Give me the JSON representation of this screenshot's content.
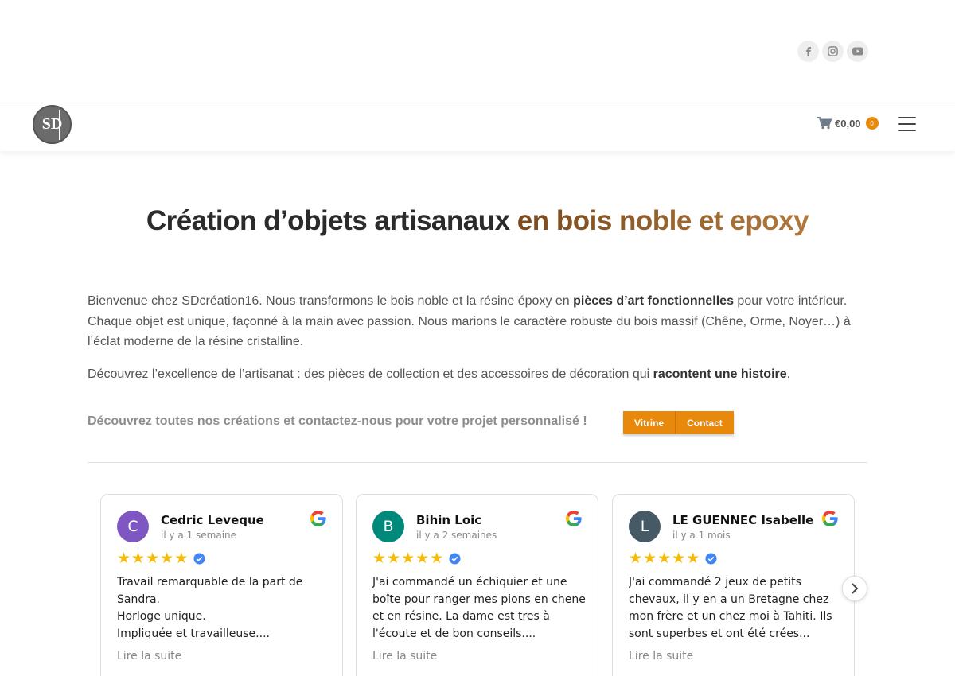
{
  "social": {
    "icons": [
      "facebook-icon",
      "instagram-icon",
      "youtube-icon"
    ]
  },
  "header": {
    "logo_text": "SD",
    "cart_amount": "€0,00",
    "cart_count": "0"
  },
  "hero": {
    "title_part1": "Création d’objets artisanaux ",
    "title_part2": "en bois noble et epoxy"
  },
  "intro": {
    "p1_a": "Bienvenue chez SDcréation16. Nous transformons le bois noble et la résine époxy en ",
    "p1_b": "pièces d’art fonctionnelles",
    "p1_c": " pour votre intérieur. Chaque objet est unique, façonné à la main avec passion. Nous marions le caractère robuste du bois massif (Chêne, Orme, Noyer…) à l’éclat moderne de la résine cristalline.",
    "p2_a": "Découvrez l’excellence de l’artisanat : des pièces de collection et des accessoires de décoration qui ",
    "p2_b": "racontent une histoire",
    "p2_c": "."
  },
  "cta": {
    "text": "Découvrez toutes nos créations et contactez-nous pour votre projet personnalisé !",
    "btn_vitrine": "Vitrine",
    "btn_contact": "Contact"
  },
  "reviews": [
    {
      "initial": "C",
      "avatar_color": "#7e57c2",
      "name": "Cedric Leveque",
      "time": "il y a 1 semaine",
      "text": "Travail remarquable de la part de Sandra.\nHorloge unique.\nImpliquée et travailleuse....",
      "more": "Lire la suite"
    },
    {
      "initial": "B",
      "avatar_color": "#00897b",
      "name": "Bihin Loic",
      "time": "il y a 2 semaines",
      "text": "J'ai commandé un échiquier et une boîte pour ranger mes pions en chene et en résine. La dame est tres à l'écoute et de bon conseils....",
      "more": "Lire la suite"
    },
    {
      "initial": "L",
      "avatar_color": "#455a64",
      "name": "LE GUENNEC Isabelle",
      "time": "il y a 1 mois",
      "text": "J'ai commandé 2 jeux de petits chevaux, il y en a un Bretagne chez mon frère et un chez moi à Tahiti. Ils sont superbes et ont été crées...",
      "more": "Lire la suite"
    }
  ],
  "colors": {
    "accent": "#e8890c",
    "star": "#f6bb06",
    "verified": "#4285f4"
  }
}
